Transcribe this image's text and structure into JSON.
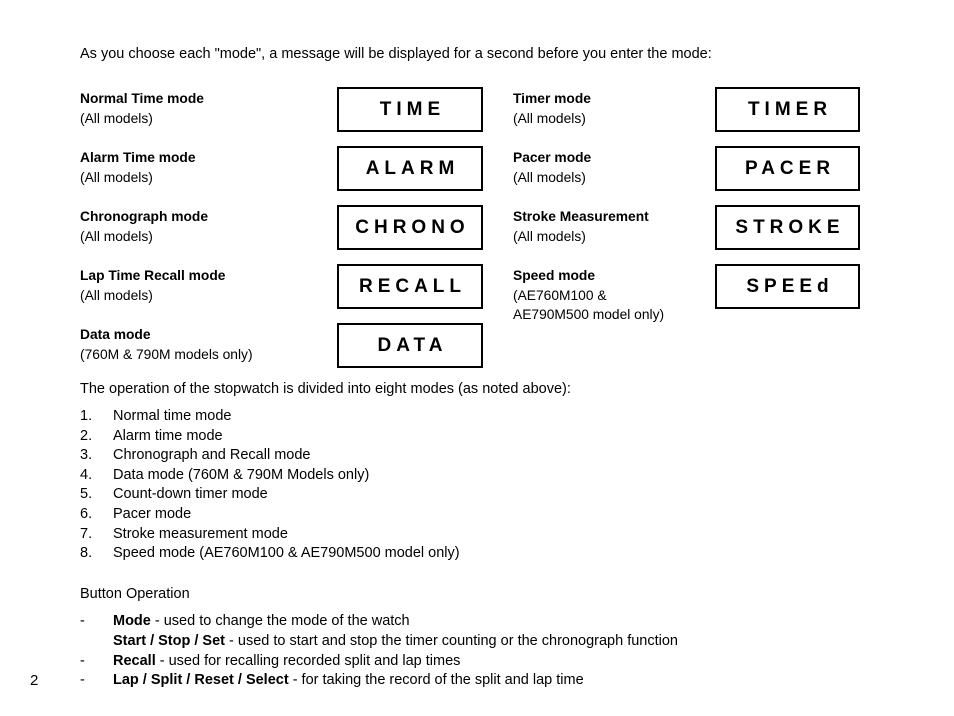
{
  "intro": {
    "text": "As you choose each \"mode\", a message will be displayed for a second before you enter the mode:"
  },
  "modes": {
    "left": [
      {
        "title": "Normal Time mode",
        "sub": "(All models)",
        "display": "TIME"
      },
      {
        "title": "Alarm Time mode",
        "sub": "(All models)",
        "display": "ALARM"
      },
      {
        "title": "Chronograph mode",
        "sub": "(All models)",
        "display": "CHRONO"
      },
      {
        "title": "Lap Time Recall mode",
        "sub": "(All models)",
        "display": "RECALL"
      },
      {
        "title": "Data mode",
        "sub": "(760M & 790M models only)",
        "display": "DATA"
      }
    ],
    "right": [
      {
        "title": "Timer mode",
        "sub": "(All models)",
        "display": "TIMER"
      },
      {
        "title": "Pacer mode",
        "sub": "(All models)",
        "display": "PACER"
      },
      {
        "title": "Stroke Measurement",
        "sub": "(All models)",
        "display": "STROKE"
      },
      {
        "title": "Speed mode",
        "sub": "(AE760M100 &",
        "sub2": "AE790M500 model only)",
        "display": "SPEEd"
      }
    ]
  },
  "divided_note": {
    "text": "The operation of the stopwatch is divided into eight modes (as noted above):"
  },
  "mode_list": [
    {
      "marker": "1.",
      "text": "Normal time mode"
    },
    {
      "marker": "2.",
      "text": "Alarm time mode"
    },
    {
      "marker": "3.",
      "text": "Chronograph and Recall mode"
    },
    {
      "marker": "4.",
      "text": "Data mode (760M & 790M Models only)"
    },
    {
      "marker": "5.",
      "text": "Count-down timer mode"
    },
    {
      "marker": "6.",
      "text": "Pacer mode"
    },
    {
      "marker": "7.",
      "text": "Stroke measurement mode"
    },
    {
      "marker": "8.",
      "text": "Speed mode (AE760M100 & AE790M500 model only)"
    }
  ],
  "button_operation": {
    "heading": "Button Operation",
    "items": [
      {
        "dash": "-",
        "name": "Mode",
        "desc": " - used to change the mode of the watch"
      },
      {
        "dash": "",
        "name": "Start / Stop / Set",
        "desc": " - used to start and stop the timer counting or the chronograph function"
      },
      {
        "dash": "-",
        "name": "Recall",
        "desc": " - used for recalling recorded split and lap times"
      },
      {
        "dash": "-",
        "name": "Lap / Split / Reset / Select",
        "desc": " - for taking the record of the split and lap time"
      }
    ]
  },
  "page_number": "2",
  "colors": {
    "text": "#000000",
    "background": "#ffffff",
    "box_border": "#000000"
  }
}
